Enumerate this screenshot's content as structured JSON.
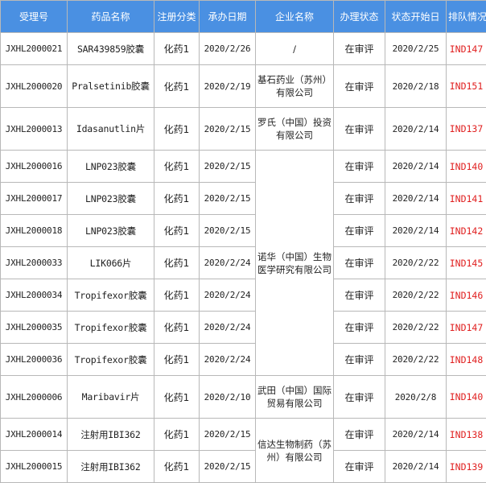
{
  "headers": [
    "受理号",
    "药品名称",
    "注册分类",
    "承办日期",
    "企业名称",
    "办理状态",
    "状态开始日",
    "排队情况"
  ],
  "rows": [
    {
      "id": "JXHL2000021",
      "drug": "SAR439859胶囊",
      "category": "化药1",
      "date": "2020/2/26",
      "company": "/",
      "status": "在审评",
      "status_date": "2020/2/25",
      "queue": "IND147"
    },
    {
      "id": "JXHL2000020",
      "drug": "Pralsetinib胶囊",
      "category": "化药1",
      "date": "2020/2/19",
      "company": "基石药业（苏州）有限公司",
      "status": "在审评",
      "status_date": "2020/2/18",
      "queue": "IND151"
    },
    {
      "id": "JXHL2000013",
      "drug": "Idasanutlin片",
      "category": "化药1",
      "date": "2020/2/15",
      "company": "罗氏（中国）投资有限公司",
      "status": "在审评",
      "status_date": "2020/2/14",
      "queue": "IND137"
    },
    {
      "id": "JXHL2000016",
      "drug": "LNP023胶囊",
      "category": "化药1",
      "date": "2020/2/15",
      "company": "诺华（中国）生物医学研究有限公司",
      "status": "在审评",
      "status_date": "2020/2/14",
      "queue": "IND140"
    },
    {
      "id": "JXHL2000017",
      "drug": "LNP023胶囊",
      "category": "化药1",
      "date": "2020/2/15",
      "status": "在审评",
      "status_date": "2020/2/14",
      "queue": "IND141"
    },
    {
      "id": "JXHL2000018",
      "drug": "LNP023胶囊",
      "category": "化药1",
      "date": "2020/2/15",
      "status": "在审评",
      "status_date": "2020/2/14",
      "queue": "IND142"
    },
    {
      "id": "JXHL2000033",
      "drug": "LIK066片",
      "category": "化药1",
      "date": "2020/2/24",
      "status": "在审评",
      "status_date": "2020/2/22",
      "queue": "IND145"
    },
    {
      "id": "JXHL2000034",
      "drug": "Tropifexor胶囊",
      "category": "化药1",
      "date": "2020/2/24",
      "status": "在审评",
      "status_date": "2020/2/22",
      "queue": "IND146"
    },
    {
      "id": "JXHL2000035",
      "drug": "Tropifexor胶囊",
      "category": "化药1",
      "date": "2020/2/24",
      "status": "在审评",
      "status_date": "2020/2/22",
      "queue": "IND147"
    },
    {
      "id": "JXHL2000036",
      "drug": "Tropifexor胶囊",
      "category": "化药1",
      "date": "2020/2/24",
      "status": "在审评",
      "status_date": "2020/2/22",
      "queue": "IND148"
    },
    {
      "id": "JXHL2000006",
      "drug": "Maribavir片",
      "category": "化药1",
      "date": "2020/2/10",
      "company": "武田（中国）国际贸易有限公司",
      "status": "在审评",
      "status_date": "2020/2/8",
      "queue": "IND140"
    },
    {
      "id": "JXHL2000014",
      "drug": "注射用IBI362",
      "category": "化药1",
      "date": "2020/2/15",
      "company": "信达生物制药（苏州）有限公司",
      "status": "在审评",
      "status_date": "2020/2/14",
      "queue": "IND138"
    },
    {
      "id": "JXHL2000015",
      "drug": "注射用IBI362",
      "category": "化药1",
      "date": "2020/2/15",
      "status": "在审评",
      "status_date": "2020/2/14",
      "queue": "IND139"
    }
  ],
  "colors": {
    "header_bg": "#4a90e2",
    "header_text": "#ffffff",
    "queue_text": "#e02020",
    "border": "#b8b8b8"
  }
}
